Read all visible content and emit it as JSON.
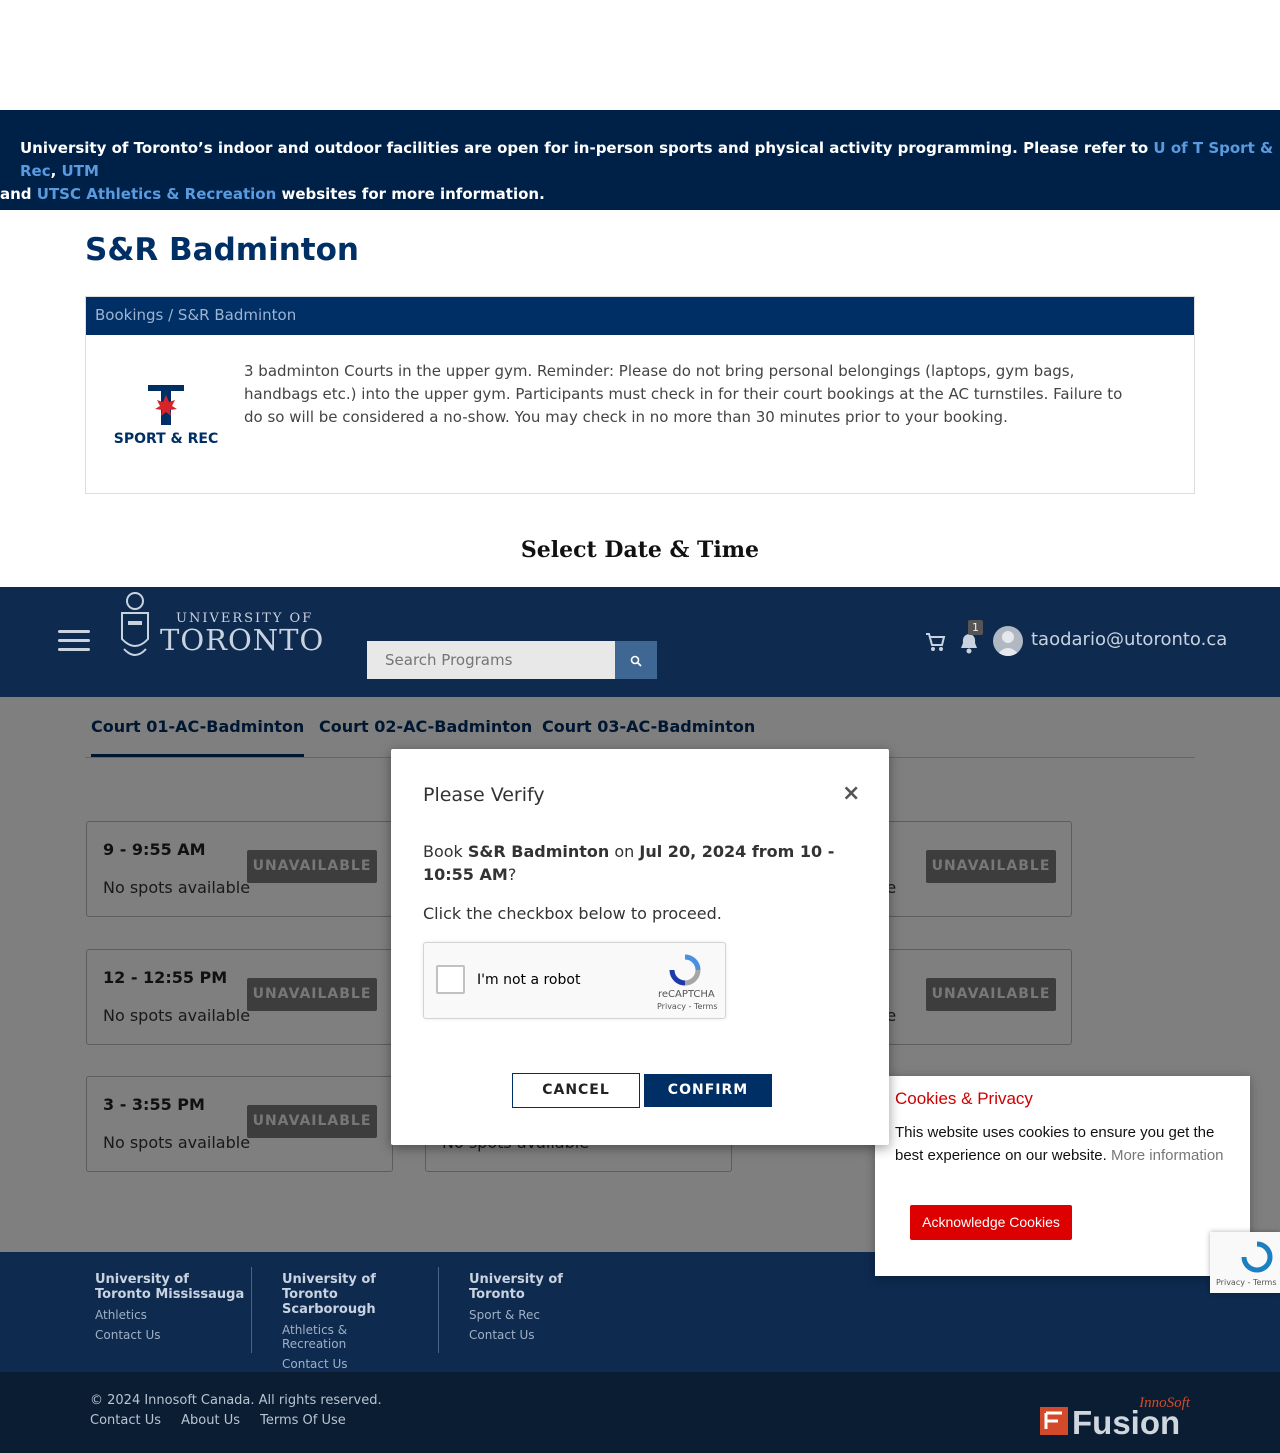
{
  "announcement": {
    "text1": "University of Toronto’s indoor and outdoor facilities are open for in-person sports and physical activity programming. Please refer to ",
    "link1": "U of T Sport & Rec",
    "sep": ", ",
    "link2": "UTM",
    "text2": "and ",
    "link3": "UTSC Athletics & Recreation",
    "text3": " websites for more information."
  },
  "page_title": "S&R Badminton",
  "card": {
    "breadcrumb": "Bookings / S&R Badminton",
    "logo_text": "SPORT & REC",
    "description": "3 badminton Courts in the upper gym. Reminder: Please do not bring personal belongings (laptops, gym bags, handbags etc.) into the upper gym. Participants must check in for their court bookings at the AC turnstiles. Failure to do so will be considered a no-show. You may check in no more than 30 minutes prior to your booking."
  },
  "select_title": "Select Date & Time",
  "nav": {
    "logo_small": "UNIVERSITY OF",
    "logo_big": "TORONTO",
    "search_placeholder": "Search Programs",
    "notification_count": "1",
    "user_email": "taodario@utoronto.ca"
  },
  "tabs": [
    "Court 01-AC-Badminton",
    "Court 02-AC-Badminton",
    "Court 03-AC-Badminton"
  ],
  "slots": [
    {
      "time": "9 - 9:55 AM",
      "availability": "No spots available",
      "button": "UNAVAILABLE"
    },
    {
      "time": "12 - 12:55 PM",
      "availability": "No spots available",
      "button": "UNAVAILABLE"
    },
    {
      "time": "3 - 3:55 PM",
      "availability": "No spots available",
      "button": "UNAVAILABLE"
    },
    {
      "time": "",
      "availability": "No spots available",
      "button": ""
    },
    {
      "time": "",
      "availability": "able",
      "button": "UNAVAILABLE"
    },
    {
      "time": "",
      "availability": "able",
      "button": "UNAVAILABLE"
    }
  ],
  "modal": {
    "title": "Please Verify",
    "close": "×",
    "q_prefix": "Book ",
    "q_program": "S&R Badminton",
    "q_on": " on ",
    "q_when": "Jul 20, 2024 from 10 - 10:55 AM",
    "q_suffix": "?",
    "hint": "Click the checkbox below to proceed.",
    "captcha_label": "I'm not a robot",
    "captcha_brand": "reCAPTCHA",
    "captcha_terms": "Privacy - Terms",
    "cancel": "CANCEL",
    "confirm": "CONFIRM"
  },
  "cookie": {
    "title": "Cookies & Privacy",
    "text": "This website uses cookies to ensure you get the best experience on our website. ",
    "more": "More information",
    "button": "Acknowledge Cookies"
  },
  "recaptcha_badge": "Privacy - Terms",
  "footer": {
    "cols": [
      {
        "title": "University of Toronto Mississauga",
        "links": [
          "Athletics",
          "Contact Us"
        ]
      },
      {
        "title": "University of Toronto Scarborough",
        "links": [
          "Athletics & Recreation",
          "Contact Us"
        ]
      },
      {
        "title": "University of Toronto",
        "links": [
          "Sport & Rec",
          "Contact Us"
        ]
      }
    ],
    "copyright": "© 2024 Innosoft Canada. All rights reserved.",
    "bottom_links": [
      "Contact Us",
      "About Us",
      "Terms Of Use"
    ],
    "brand_small": "InnoSoft",
    "brand_big": "Fusion"
  },
  "colors": {
    "navy": "#002f65",
    "cookie_red": "#dd0000",
    "link_blue": "#5a9be0"
  }
}
